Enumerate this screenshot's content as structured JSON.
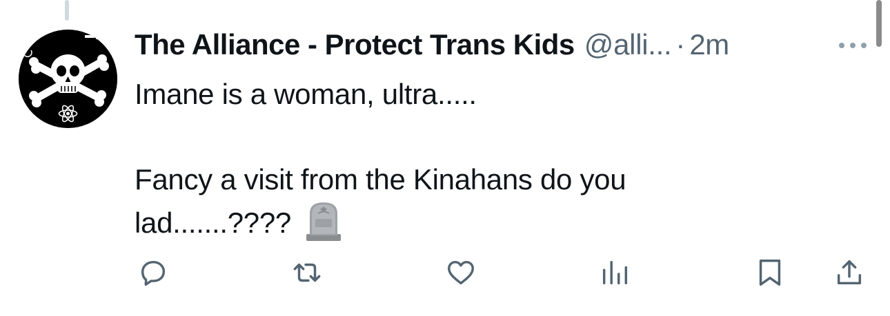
{
  "tweet": {
    "display_name": "The Alliance - Protect Trans Kids",
    "handle": "@alli...",
    "separator": "·",
    "timestamp": "2m",
    "text_lines": [
      "Imane is a woman, ultra.....",
      "",
      "Fancy a visit from the Kinahans do you",
      "lad.......????"
    ],
    "emoji": "headstone"
  },
  "actions": [
    {
      "name": "reply",
      "icon": "reply-icon"
    },
    {
      "name": "retweet",
      "icon": "retweet-icon"
    },
    {
      "name": "like",
      "icon": "heart-icon"
    },
    {
      "name": "views",
      "icon": "views-icon"
    },
    {
      "name": "bookmark",
      "icon": "bookmark-icon"
    },
    {
      "name": "share",
      "icon": "share-icon"
    }
  ],
  "colors": {
    "text": "#0f1419",
    "secondary": "#536471",
    "thread_line": "#cfd9de"
  }
}
